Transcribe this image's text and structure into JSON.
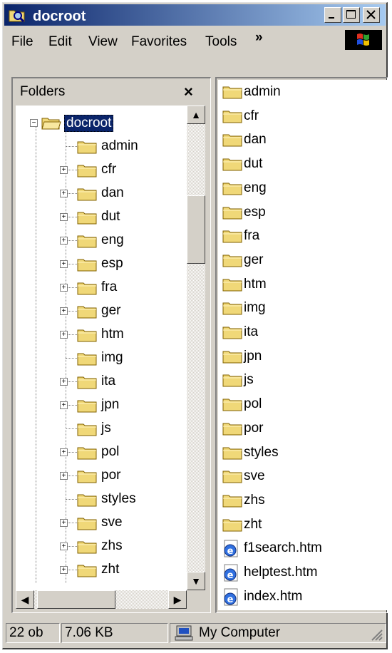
{
  "window": {
    "title": "docroot"
  },
  "menu": {
    "items": [
      "File",
      "Edit",
      "View",
      "Favorites",
      "Tools"
    ],
    "more": "»"
  },
  "folders_pane": {
    "header": "Folders",
    "close": "×",
    "root": "docroot",
    "items": [
      {
        "label": "admin",
        "expandable": false
      },
      {
        "label": "cfr",
        "expandable": true
      },
      {
        "label": "dan",
        "expandable": true
      },
      {
        "label": "dut",
        "expandable": true
      },
      {
        "label": "eng",
        "expandable": true
      },
      {
        "label": "esp",
        "expandable": true
      },
      {
        "label": "fra",
        "expandable": true
      },
      {
        "label": "ger",
        "expandable": true
      },
      {
        "label": "htm",
        "expandable": true
      },
      {
        "label": "img",
        "expandable": false
      },
      {
        "label": "ita",
        "expandable": true
      },
      {
        "label": "jpn",
        "expandable": true
      },
      {
        "label": "js",
        "expandable": false
      },
      {
        "label": "pol",
        "expandable": true
      },
      {
        "label": "por",
        "expandable": true
      },
      {
        "label": "styles",
        "expandable": false
      },
      {
        "label": "sve",
        "expandable": true
      },
      {
        "label": "zhs",
        "expandable": true
      },
      {
        "label": "zht",
        "expandable": true
      }
    ]
  },
  "contents": {
    "folders": [
      "admin",
      "cfr",
      "dan",
      "dut",
      "eng",
      "esp",
      "fra",
      "ger",
      "htm",
      "img",
      "ita",
      "jpn",
      "js",
      "pol",
      "por",
      "styles",
      "sve",
      "zhs",
      "zht"
    ],
    "files": [
      "f1search.htm",
      "helptest.htm",
      "index.htm"
    ]
  },
  "status": {
    "objects": "22 ob",
    "size": "7.06 KB",
    "zone": "My Computer"
  },
  "colors": {
    "title_start": "#0a246a",
    "title_end": "#a6caf0",
    "folder": "#f0d878",
    "selection": "#0a246a"
  }
}
